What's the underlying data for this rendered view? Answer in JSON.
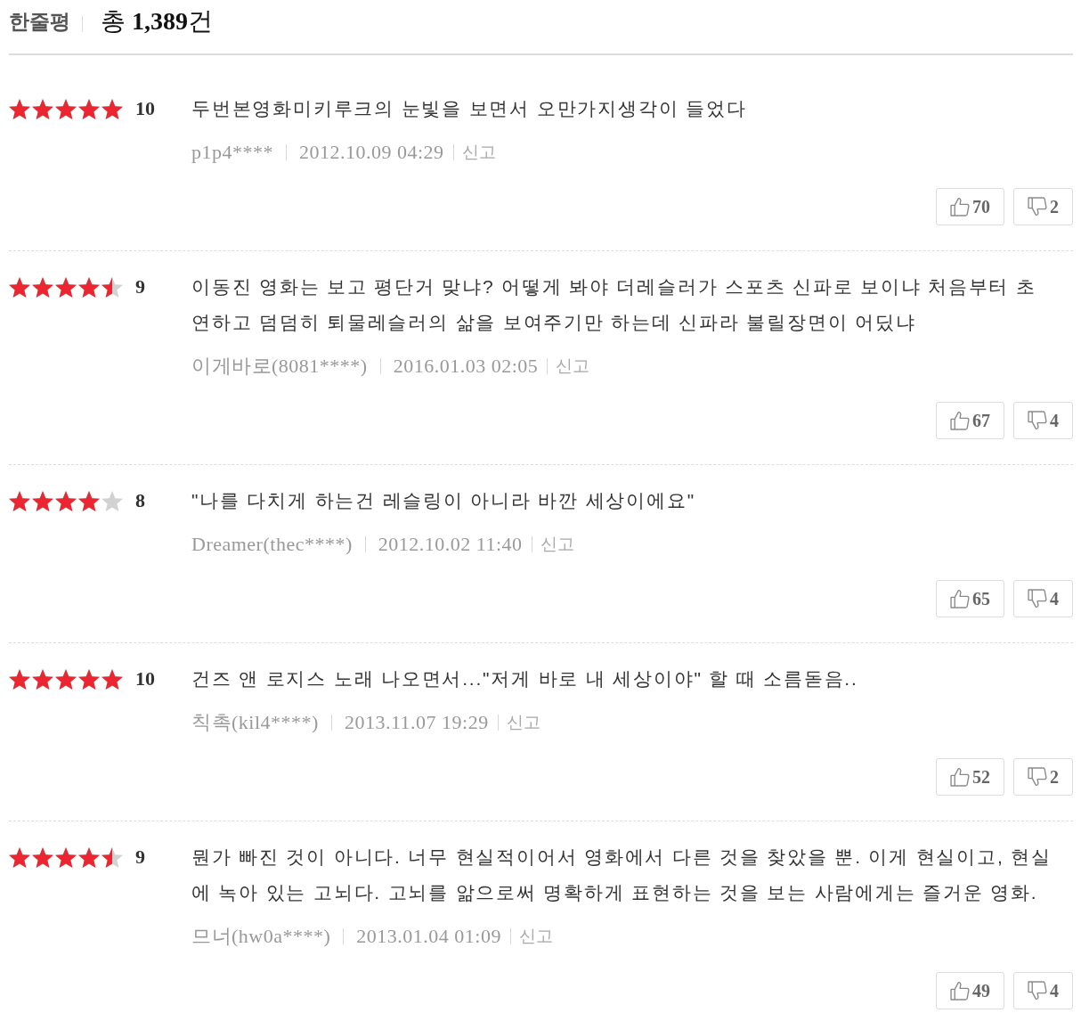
{
  "header": {
    "title": "한줄평",
    "total": "총 **1,389**건"
  },
  "reviews": [
    {
      "stars": 5,
      "score": "10",
      "text": "두번본영화미키루크의 눈빛을 보면서 오만가지생각이 들었다",
      "author": "p1p4****",
      "date": "2012.10.09 04:29",
      "report": "신고",
      "likes": "70",
      "dislikes": "2"
    },
    {
      "stars": 4.5,
      "score": "9",
      "text": "이동진 영화는 보고 평단거 맞냐? 어떻게 봐야 더레슬러가 스포츠 신파로 보이냐 처음부터 초연하고 덤덤히 퇴물레슬러의 삶을 보여주기만 하는데 신파라 불릴장면이 어딨냐",
      "author": "이게바로(8081****)",
      "date": "2016.01.03 02:05",
      "report": "신고",
      "likes": "67",
      "dislikes": "4"
    },
    {
      "stars": 4,
      "score": "8",
      "text": "\"나를 다치게 하는건 레슬링이 아니라 바깐 세상이에요\"",
      "author": "Dreamer(thec****)",
      "date": "2012.10.02 11:40",
      "report": "신고",
      "likes": "65",
      "dislikes": "4"
    },
    {
      "stars": 5,
      "score": "10",
      "text": "건즈 앤 로지스 노래 나오면서...\"저게 바로 내 세상이야\" 할 때 소름돋음..",
      "author": "칙촉(kil4****)",
      "date": "2013.11.07 19:29",
      "report": "신고",
      "likes": "52",
      "dislikes": "2"
    },
    {
      "stars": 4.5,
      "score": "9",
      "text": "뭔가 빠진 것이 아니다. 너무 현실적이어서 영화에서 다른 것을 찾았을 뿐. 이게 현실이고, 현실에 녹아 있는 고뇌다. 고뇌를 앎으로써 명확하게 표현하는 것을 보는 사람에게는 즐거운 영화.",
      "author": "므너(hw0a****)",
      "date": "2013.01.04 01:09",
      "report": "신고",
      "likes": "49",
      "dislikes": "4"
    }
  ]
}
